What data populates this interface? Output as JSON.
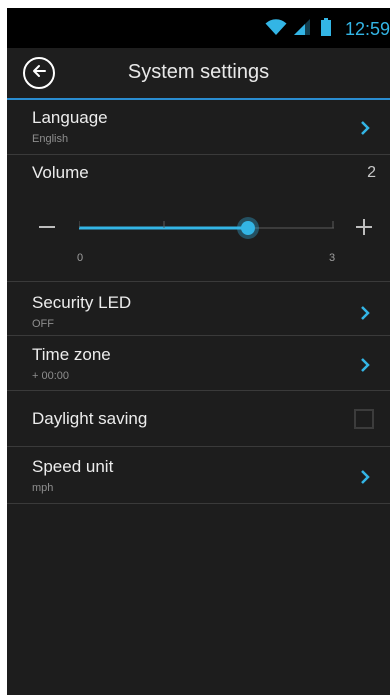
{
  "status_bar": {
    "time": "12:59",
    "wifi_icon": "wifi-icon",
    "signal_icon": "signal-icon",
    "battery_icon": "battery-icon"
  },
  "app_bar": {
    "title": "System settings",
    "back_icon": "back-arrow-icon"
  },
  "settings": {
    "language": {
      "title": "Language",
      "value": "English"
    },
    "volume": {
      "title": "Volume",
      "value": "2",
      "min_label": "0",
      "max_label": "3",
      "level": 2,
      "min": 0,
      "max": 3
    },
    "security_led": {
      "title": "Security LED",
      "value": "OFF"
    },
    "time_zone": {
      "title": "Time zone",
      "value": "+ 00:00"
    },
    "daylight_saving": {
      "title": "Daylight saving",
      "checked": false
    },
    "speed_unit": {
      "title": "Speed unit",
      "value": "mph"
    }
  },
  "colors": {
    "accent": "#33b5e5",
    "background": "#1d1d1d",
    "divider": "#3a3a3a"
  }
}
